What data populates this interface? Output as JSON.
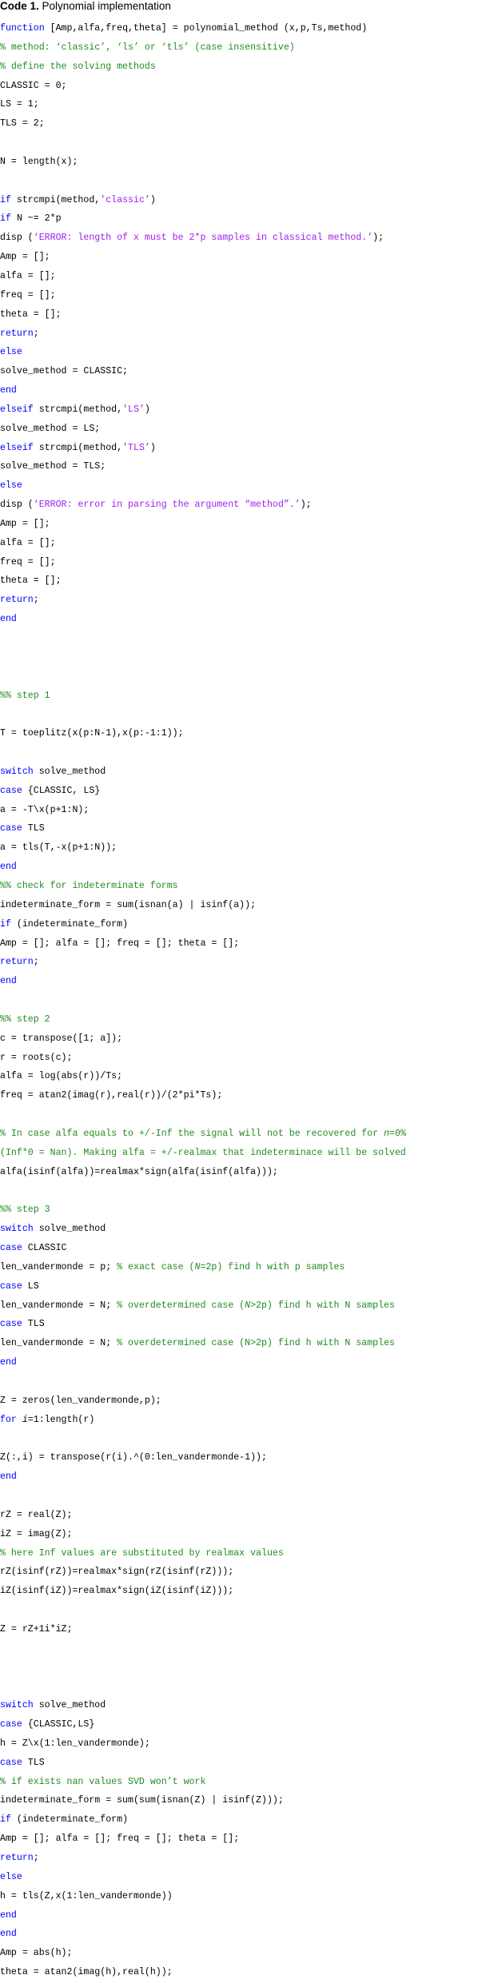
{
  "title": {
    "label": "Code 1.",
    "text": " Polynomial implementation"
  },
  "colors": {
    "keyword": "#0000ff",
    "comment": "#228b22",
    "string": "#a020f0",
    "text": "#000000"
  },
  "lines": [
    [
      [
        "kw",
        "function"
      ],
      [
        "t",
        " [Amp,alfa,freq,theta] = polynomial_method (x,p,Ts,method)"
      ]
    ],
    [
      [
        "cm",
        "% method: ‘classic’, ‘ls’ or ‘tls’ (case insensitive)"
      ]
    ],
    [
      [
        "cm",
        "% define the solving methods"
      ]
    ],
    [
      [
        "t",
        "CLASSIC = 0;"
      ]
    ],
    [
      [
        "t",
        "LS = 1;"
      ]
    ],
    [
      [
        "t",
        "TLS = 2;"
      ]
    ],
    [],
    [
      [
        "t",
        "N = length(x);"
      ]
    ],
    [],
    [
      [
        "kw",
        "if"
      ],
      [
        "t",
        " strcmpi(method,"
      ],
      [
        "str",
        "'classic’"
      ],
      [
        "t",
        ")"
      ]
    ],
    [
      [
        "kw",
        "if"
      ],
      [
        "t",
        " N ~= 2*p"
      ]
    ],
    [
      [
        "t",
        "disp ("
      ],
      [
        "str",
        "‘ERROR: length of x must be 2*p samples in classical method.’"
      ],
      [
        "t",
        ");"
      ]
    ],
    [
      [
        "t",
        "Amp = [];"
      ]
    ],
    [
      [
        "t",
        "alfa = [];"
      ]
    ],
    [
      [
        "t",
        "freq = [];"
      ]
    ],
    [
      [
        "t",
        "theta = [];"
      ]
    ],
    [
      [
        "kw",
        "return"
      ],
      [
        "t",
        ";"
      ]
    ],
    [
      [
        "kw",
        "else"
      ]
    ],
    [
      [
        "t",
        "solve_method = CLASSIC;"
      ]
    ],
    [
      [
        "kw",
        "end"
      ]
    ],
    [
      [
        "kw",
        "elseif"
      ],
      [
        "t",
        " strcmpi(method,"
      ],
      [
        "str",
        "'LS’"
      ],
      [
        "t",
        ")"
      ]
    ],
    [
      [
        "t",
        "solve_method = LS;"
      ]
    ],
    [
      [
        "kw",
        "elseif"
      ],
      [
        "t",
        " strcmpi(method,"
      ],
      [
        "str",
        "'TLS’"
      ],
      [
        "t",
        ")"
      ]
    ],
    [
      [
        "t",
        "solve_method = TLS;"
      ]
    ],
    [
      [
        "kw",
        "else"
      ]
    ],
    [
      [
        "t",
        "disp ("
      ],
      [
        "str",
        "‘ERROR: error in parsing the argument “method”.’"
      ],
      [
        "t",
        ");"
      ]
    ],
    [
      [
        "t",
        "Amp = [];"
      ]
    ],
    [
      [
        "t",
        "alfa = [];"
      ]
    ],
    [
      [
        "t",
        "freq = [];"
      ]
    ],
    [
      [
        "t",
        "theta = [];"
      ]
    ],
    [
      [
        "kw",
        "return"
      ],
      [
        "t",
        ";"
      ]
    ],
    [
      [
        "kw",
        "end"
      ]
    ],
    [],
    [],
    [],
    [
      [
        "cm",
        "%% step 1"
      ]
    ],
    [],
    [
      [
        "t",
        "T = toeplitz(x(p:N-1),x(p:-1:1));"
      ]
    ],
    [],
    [
      [
        "kw",
        "switch"
      ],
      [
        "t",
        " solve_method"
      ]
    ],
    [
      [
        "kw",
        "case"
      ],
      [
        "t",
        " {CLASSIC, LS}"
      ]
    ],
    [
      [
        "t",
        "a = -T\\x(p+1:N);"
      ]
    ],
    [
      [
        "kw",
        "case"
      ],
      [
        "t",
        " TLS"
      ]
    ],
    [
      [
        "t",
        "a = tls(T,-x(p+1:N));"
      ]
    ],
    [
      [
        "kw",
        "end"
      ]
    ],
    [
      [
        "cm",
        "%% check for indeterminate forms"
      ]
    ],
    [
      [
        "t",
        "indeterminate_form = sum(isnan(a) | isinf(a));"
      ]
    ],
    [
      [
        "kw",
        "if"
      ],
      [
        "t",
        " (indeterminate_form)"
      ]
    ],
    [
      [
        "t",
        "Amp = []; alfa = []; freq = []; theta = [];"
      ]
    ],
    [
      [
        "kw",
        "return"
      ],
      [
        "t",
        ";"
      ]
    ],
    [
      [
        "kw",
        "end"
      ]
    ],
    [],
    [
      [
        "cm",
        "%% step 2"
      ]
    ],
    [
      [
        "t",
        "c = transpose([1; a]);"
      ]
    ],
    [
      [
        "t",
        "r = roots(c);"
      ]
    ],
    [
      [
        "t",
        "alfa = log(abs(r))/Ts;"
      ]
    ],
    [
      [
        "t",
        "freq = atan2(imag(r),real(r))/(2*pi*Ts);"
      ]
    ],
    [],
    [
      [
        "cm",
        "% In case alfa equals to +/-Inf the signal will not be recovered for "
      ],
      [
        "cmi",
        "n"
      ],
      [
        "cm",
        "=0%"
      ]
    ],
    [
      [
        "cm",
        "(Inf*0 = Nan). Making alfa = +/-realmax that indeterminace will be solved"
      ]
    ],
    [
      [
        "t",
        "alfa(isinf(alfa))=realmax*sign(alfa(isinf(alfa)));"
      ]
    ],
    [],
    [
      [
        "cm",
        "%% step 3"
      ]
    ],
    [
      [
        "kw",
        "switch"
      ],
      [
        "t",
        " solve_method"
      ]
    ],
    [
      [
        "kw",
        "case"
      ],
      [
        "t",
        " CLASSIC"
      ]
    ],
    [
      [
        "t",
        "len_vandermonde = p; "
      ],
      [
        "cm",
        "% exact case ("
      ],
      [
        "cmi",
        "N"
      ],
      [
        "cm",
        "=2p) find h with p samples"
      ]
    ],
    [
      [
        "kw",
        "case"
      ],
      [
        "t",
        " LS"
      ]
    ],
    [
      [
        "t",
        "len_vandermonde = N; "
      ],
      [
        "cm",
        "% overdetermined case ("
      ],
      [
        "cmi",
        "N"
      ],
      [
        "cm",
        ">2p) find h with N samples"
      ]
    ],
    [
      [
        "kw",
        "case"
      ],
      [
        "t",
        " TLS"
      ]
    ],
    [
      [
        "t",
        "len_vandermonde = N; "
      ],
      [
        "cm",
        "% overdetermined case (N>2p) find h with N samples"
      ]
    ],
    [
      [
        "kw",
        "end"
      ]
    ],
    [],
    [
      [
        "t",
        "Z = zeros(len_vandermonde,p);"
      ]
    ],
    [
      [
        "kw",
        "for"
      ],
      [
        "t",
        " "
      ],
      [
        "ti",
        "i"
      ],
      [
        "t",
        "=1:length(r)"
      ]
    ],
    [],
    [
      [
        "t",
        "Z(:,i) = transpose(r(i).^(0:len_vandermonde-1));"
      ]
    ],
    [
      [
        "kw",
        "end"
      ]
    ],
    [],
    [
      [
        "t",
        "rZ = real(Z);"
      ]
    ],
    [
      [
        "t",
        "iZ = imag(Z);"
      ]
    ],
    [
      [
        "cm",
        "% here Inf values are substituted by realmax values"
      ]
    ],
    [
      [
        "t",
        "rZ(isinf(rZ))=realmax*sign(rZ(isinf(rZ)));"
      ]
    ],
    [
      [
        "t",
        "iZ(isinf(iZ))=realmax*sign(iZ(isinf(iZ)));"
      ]
    ],
    [],
    [
      [
        "t",
        "Z = rZ+1i*iZ;"
      ]
    ],
    [],
    [],
    [],
    [
      [
        "kw",
        "switch"
      ],
      [
        "t",
        " solve_method"
      ]
    ],
    [
      [
        "kw",
        "case"
      ],
      [
        "t",
        " {CLASSIC,LS}"
      ]
    ],
    [
      [
        "t",
        "h = Z\\x(1:len_vandermonde);"
      ]
    ],
    [
      [
        "kw",
        "case"
      ],
      [
        "t",
        " TLS"
      ]
    ],
    [
      [
        "cm",
        "% if exists nan values SVD won’t work"
      ]
    ],
    [
      [
        "t",
        "indeterminate_form = sum(sum(isnan(Z) | isinf(Z)));"
      ]
    ],
    [
      [
        "kw",
        "if"
      ],
      [
        "t",
        " (indeterminate_form)"
      ]
    ],
    [
      [
        "t",
        "Amp = []; alfa = []; freq = []; theta = [];"
      ]
    ],
    [
      [
        "kw",
        "return"
      ],
      [
        "t",
        ";"
      ]
    ],
    [
      [
        "kw",
        "else"
      ]
    ],
    [
      [
        "t",
        "h = tls(Z,x(1:len_vandermonde))"
      ]
    ],
    [
      [
        "kw",
        "end"
      ]
    ],
    [
      [
        "kw",
        "end"
      ]
    ],
    [
      [
        "t",
        "Amp = abs(h);"
      ]
    ],
    [
      [
        "t",
        "theta = atan2(imag(h),real(h));"
      ]
    ]
  ]
}
